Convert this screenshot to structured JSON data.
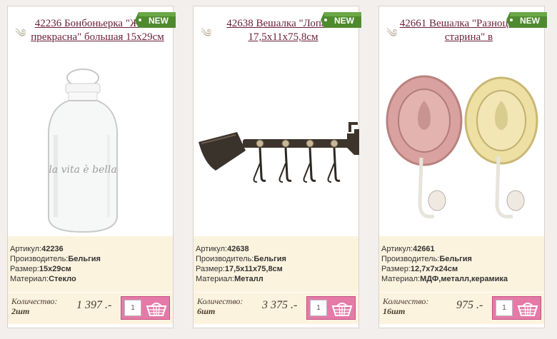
{
  "badge_label": "NEW",
  "labels": {
    "article": "Артикул:",
    "maker": "Производитель:",
    "size": "Размер:",
    "material": "Материал:",
    "quantity": "Количество:"
  },
  "products": [
    {
      "title": "42236 Бонбоньерка \"Жизнь прекрасна\" большая 15х29см",
      "article": "42236",
      "maker": "Бельгия",
      "size": "15х29см",
      "material": "Стекло",
      "quantity": "2шт",
      "price": "1 397 .-",
      "cart_qty": "1",
      "jar_text": "la vita è bella"
    },
    {
      "title": "42638 Вешалка \"Лопата\" 17,5х11х75,8см",
      "article": "42638",
      "maker": "Бельгия",
      "size": "17,5х11х75,8см",
      "material": "Металл",
      "quantity": "6шт",
      "price": "3 375 .-",
      "cart_qty": "1"
    },
    {
      "title": "42661 Вешалка \"Разноцветная старина\" в",
      "article": "42661",
      "maker": "Бельгия",
      "size": "12,7х7х24см",
      "material": "МДФ,металл,керамика",
      "quantity": "16шт",
      "price": "975 .-",
      "cart_qty": "1"
    }
  ],
  "colors": {
    "title_link": "#6b1d3a",
    "badge": "#4f8a2f",
    "info_bg": "#fcf3df",
    "cart_button": "#e57aa9"
  }
}
